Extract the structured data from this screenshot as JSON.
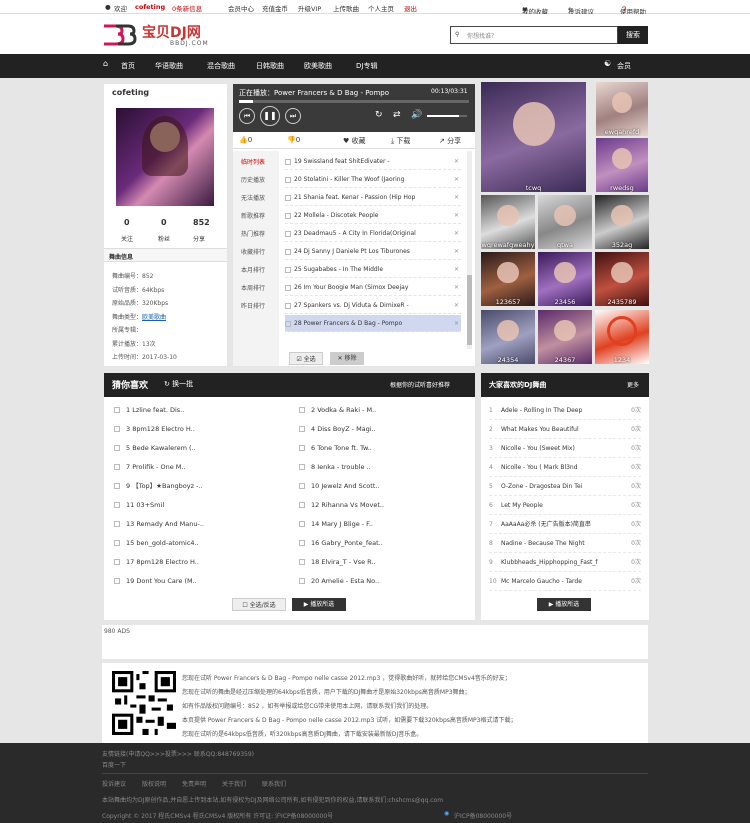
{
  "topbar": {
    "welcome": "欢迎",
    "username": "cofeting",
    "messages": "0条新信息",
    "member_center": "会员中心",
    "recharge": "充值金币",
    "upgrade_vip": "升级VIP",
    "upload": "上传歌曲",
    "homepage": "个人主页",
    "logout": "退出",
    "favorites": "我的收藏",
    "feedback": "投诉建议",
    "help": "使用帮助"
  },
  "logo": {
    "text": "宝贝DJ网",
    "sub": "BBDJ.COM"
  },
  "search": {
    "placeholder": "你想找谁？",
    "button": "搜索"
  },
  "nav": {
    "items": [
      "首页",
      "华语歌曲",
      "混合歌曲",
      "日韩歌曲",
      "欧美歌曲",
      "DJ专辑"
    ],
    "member": "会员"
  },
  "user": {
    "name": "cofeting",
    "stats": [
      {
        "num": "0",
        "label": "关注"
      },
      {
        "num": "0",
        "label": "粉丝"
      },
      {
        "num": "852",
        "label": "分享"
      }
    ],
    "section": "舞曲信息",
    "info": [
      "舞曲编号：852",
      "试听音质：64Kbps",
      "原始品质：320Kbps",
      "舞曲类型：欧美歌曲",
      "所属专辑：",
      "累计播放：13次",
      "上传时间：2017-03-10"
    ],
    "info_type_link": "欧美歌曲"
  },
  "player": {
    "now_playing": "正在播放：Power Francers & D Bag - Pompo",
    "time": "00:13/03:31",
    "progress": 0.06,
    "volume": 0.8,
    "actions": [
      {
        "icon": "thumbs-up-icon",
        "label": "0"
      },
      {
        "icon": "thumbs-down-icon",
        "label": "0"
      },
      {
        "icon": "heart-icon",
        "label": "收藏"
      },
      {
        "icon": "download-icon",
        "label": "下载"
      },
      {
        "icon": "share-icon",
        "label": "分享"
      }
    ],
    "tabs": [
      "临时列表",
      "历史播放",
      "无法播放",
      "新歌推荐",
      "热门推荐",
      "收藏排行",
      "本月排行",
      "本周排行",
      "昨日排行"
    ],
    "tracks": [
      "19 Swissland feat ShitEdivater -",
      "20 Stolatini - Killer The Woof (Jaoring",
      "21 Shania feat. Kenar - Passion (Hip Hop",
      "22 Mollela - Discotek People",
      "23 Deadmau5 - A City In Florida(Original",
      "24 Dj Sanny J Daniele Pt Los Tiburones",
      "25 Sugababes - In The Middle",
      "26 Im Your Boogie Man (Simox Deejay",
      "27 Spankers vs. Dj Viduta & DimixeR -",
      "28 Power Francers & D Bag - Pompo"
    ],
    "select_all": "全选",
    "remove": "移除"
  },
  "djs": [
    "tcwq",
    "ewqahrefd",
    "rwedsg",
    "wqrewafgweahy",
    "qtwa",
    "352ag",
    "123657",
    "23456",
    "2435789",
    "24354",
    "24367",
    "1234"
  ],
  "guess": {
    "title": "猜你喜欢",
    "refresh": "换一批",
    "subtitle": "根据你的试听喜好推荐",
    "left": [
      "1 Lzline feat. Dis..",
      "3 8pm128 Electro H..",
      "5 Bede Kawalerem (..",
      "7 Prolifik - One M..",
      "9 【Top】★Bangboyz -..",
      "11 03+Smil",
      "13 Remady And Manu-..",
      "15 ben_gold-atomic4..",
      "17 8pm128 Electro H..",
      "19 Dont You Care (M.."
    ],
    "right": [
      "2 Vodka & Raki - M..",
      "4 Diss BoyZ - Magi..",
      "6 Tone Tone ft. Tw..",
      "8 Ienka - trouble ..",
      "10 Jewelz And Scott..",
      "12 Rihanna Vs Movet..",
      "14 Mary J Blige - F..",
      "16 Gabry_Ponte_feat..",
      "18 Elvira_T - Vse R..",
      "20 Amelie - Esta No.."
    ],
    "select_all": "全选/反选",
    "play_selected": "播放所选"
  },
  "likes": {
    "title": "大家喜欢的DJ舞曲",
    "more": "更多",
    "items": [
      {
        "n": "1",
        "t": "Adele - Rolling In The Deep",
        "c": "0次"
      },
      {
        "n": "2",
        "t": "What Makes You Beautiful",
        "c": "0次"
      },
      {
        "n": "3",
        "t": "Nicolle - You (Sweet Mix)",
        "c": "0次"
      },
      {
        "n": "4",
        "t": "Nicolle - You ( Mark Bl3nd",
        "c": "0次"
      },
      {
        "n": "5",
        "t": "O-Zone - Dragostea Din Tei",
        "c": "0次"
      },
      {
        "n": "6",
        "t": "Let My People",
        "c": "0次"
      },
      {
        "n": "7",
        "t": "AaAaAa必杀 (无广告版本)简直串",
        "c": "0次"
      },
      {
        "n": "8",
        "t": "Nadine - Because The Night",
        "c": "0次"
      },
      {
        "n": "9",
        "t": "Klubbheads_Hipphopping_Fast_f",
        "c": "0次"
      },
      {
        "n": "10",
        "t": "Mc Marcelo Gaucho - Tarde",
        "c": "0次"
      }
    ],
    "play_selected": "播放所选"
  },
  "ads": "980 ADS",
  "info_lines": [
    "您现在试听 Power Francers & D Bag - Pompo nelle casse 2012.mp3 ，觉得歌曲好听，就转给您CMSv4音乐的好友；",
    "您现在试听的舞曲是经过压缩处理的64kbps低音质，用户下载的DJ舞曲才是原始320kbps高音质MP3舞曲；",
    "如有作品版权问题编号：852 ，如有举报或给您CG带来使用本上网，请联系我们我们的处理。",
    "本页提供 Power Francers & D Bag - Pompo nelle casse 2012.mp3 试听，如需要下载320kbps高音质MP3格式请下载；",
    "您现在试听的是64kbps低音质，听320kbps高音质DJ舞曲，请下载安装最新版DJ音乐盒。"
  ],
  "footer": {
    "line1": "友情链接(申请QQ>>>投票>>> 联系QQ:848769359)",
    "line2": "百度一下",
    "links": [
      "投诉建议",
      "版权说明",
      "免责声明",
      "关于我们",
      "联系我们"
    ],
    "notice": "本站舞曲均为DJ原创作品,并自愿上传到本站,如有侵权为DJ及网络公司所有,如有侵犯到你的权益,请联系我们:chshcms@qq.com",
    "copyright": "Copyright © 2017 程氏CMSv4 程氏CMSv4 版权所有   许可证: 沪ICP备08000000号",
    "icp": "沪ICP备08000000号"
  }
}
